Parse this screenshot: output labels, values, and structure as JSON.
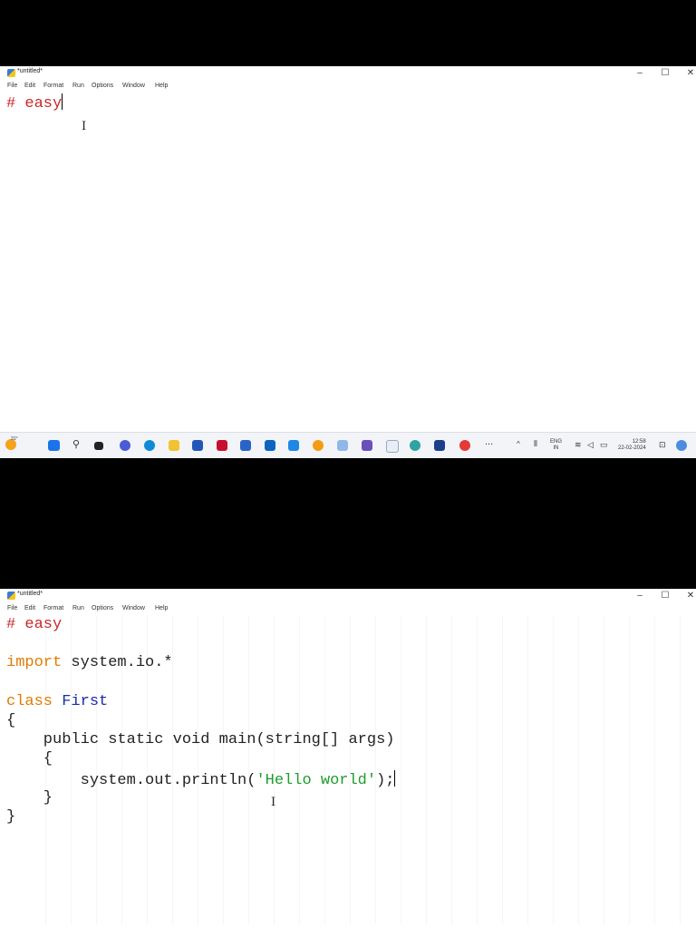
{
  "window": {
    "title": "*untitled*",
    "min_glyph": "–",
    "max_glyph": "☐",
    "close_glyph": "✕"
  },
  "menu": [
    "File",
    "Edit",
    "Format",
    "Run",
    "Options",
    "Window",
    "Help"
  ],
  "screen1": {
    "code": {
      "comment": "# easy"
    }
  },
  "screen2": {
    "code": {
      "comment": "# easy",
      "import_kw": "import",
      "import_rest": " system.io.*",
      "class_kw": "class",
      "class_name": " First",
      "open_brace": "{",
      "method_sig": "    public static void main(string[] args)",
      "method_open": "    {",
      "print_pre": "        system.out.println(",
      "print_str": "'Hello world'",
      "print_post": ");",
      "method_close": "    }",
      "close_brace": "}"
    }
  },
  "taskbar": {
    "weather_temp": "31°",
    "more": "...",
    "lang_top": "ENG",
    "lang_bottom": "IN",
    "time": "12:58",
    "date": "22-02-2024"
  },
  "colors": {
    "comment": "#c62828",
    "keyword": "#e07b00",
    "definition": "#1d2ba8",
    "string": "#1d9e2e"
  }
}
